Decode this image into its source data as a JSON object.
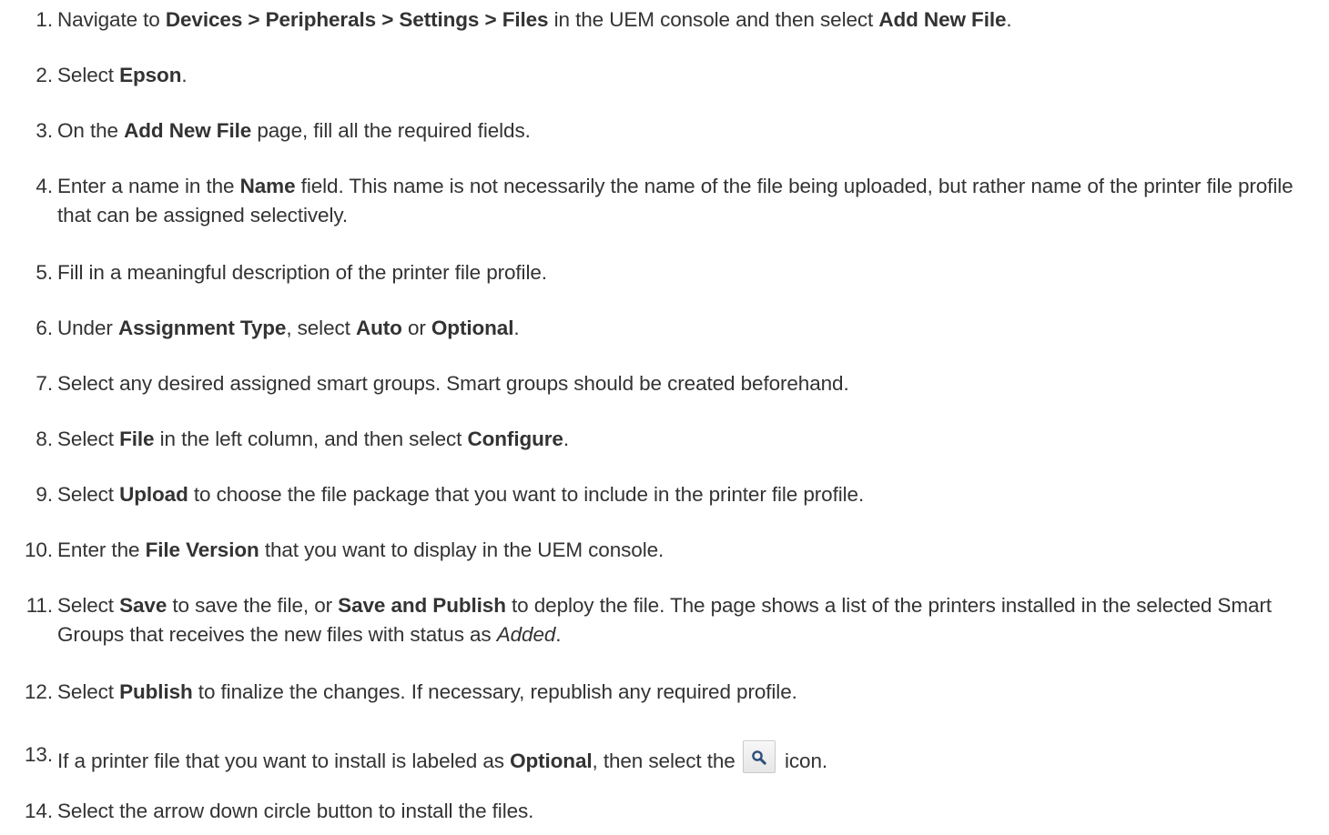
{
  "steps": [
    {
      "num": "1.",
      "parts": [
        {
          "t": "Navigate to "
        },
        {
          "t": "Devices > Peripherals > Settings > Files",
          "b": true
        },
        {
          "t": " in the UEM console and then select "
        },
        {
          "t": "Add New File",
          "b": true
        },
        {
          "t": "."
        }
      ]
    },
    {
      "num": "2.",
      "parts": [
        {
          "t": "Select "
        },
        {
          "t": "Epson",
          "b": true
        },
        {
          "t": "."
        }
      ]
    },
    {
      "num": "3.",
      "parts": [
        {
          "t": "On the "
        },
        {
          "t": "Add New File",
          "b": true
        },
        {
          "t": " page, fill all the required fields."
        }
      ]
    },
    {
      "num": "4.",
      "parts": [
        {
          "t": "Enter a name in the "
        },
        {
          "t": "Name",
          "b": true
        },
        {
          "t": " field. This name is not necessarily the name of the file being uploaded, but rather name of the printer file profile that can be assigned selectively."
        }
      ]
    },
    {
      "num": "5.",
      "parts": [
        {
          "t": "Fill in a meaningful description of the printer file profile."
        }
      ]
    },
    {
      "num": "6.",
      "parts": [
        {
          "t": "Under "
        },
        {
          "t": "Assignment Type",
          "b": true
        },
        {
          "t": ", select "
        },
        {
          "t": "Auto",
          "b": true
        },
        {
          "t": " or "
        },
        {
          "t": "Optional",
          "b": true
        },
        {
          "t": "."
        }
      ]
    },
    {
      "num": "7.",
      "parts": [
        {
          "t": "Select any desired assigned smart groups. Smart groups should be created beforehand."
        }
      ]
    },
    {
      "num": "8.",
      "parts": [
        {
          "t": "Select "
        },
        {
          "t": "File",
          "b": true
        },
        {
          "t": " in the left column, and then select "
        },
        {
          "t": "Configure",
          "b": true
        },
        {
          "t": "."
        }
      ]
    },
    {
      "num": "9.",
      "parts": [
        {
          "t": "Select "
        },
        {
          "t": "Upload",
          "b": true
        },
        {
          "t": " to choose the file package that you want to include in the printer file profile."
        }
      ]
    },
    {
      "num": "10.",
      "parts": [
        {
          "t": "Enter the "
        },
        {
          "t": "File Version",
          "b": true
        },
        {
          "t": " that you want to display in the UEM console."
        }
      ]
    },
    {
      "num": "11.",
      "parts": [
        {
          "t": "Select "
        },
        {
          "t": "Save",
          "b": true
        },
        {
          "t": " to save the file, or "
        },
        {
          "t": "Save and Publish",
          "b": true
        },
        {
          "t": " to deploy the file. The page shows a list of the printers installed in the selected Smart Groups that receives the new files with status as "
        },
        {
          "t": "Added",
          "i": true
        },
        {
          "t": "."
        }
      ]
    },
    {
      "num": "12.",
      "parts": [
        {
          "t": "Select "
        },
        {
          "t": "Publish",
          "b": true
        },
        {
          "t": " to finalize the changes. If necessary, republish any required profile."
        }
      ]
    },
    {
      "num": "13.",
      "parts": [
        {
          "t": "If a printer file that you want to install is labeled as "
        },
        {
          "t": "Optional",
          "b": true
        },
        {
          "t": ", then select the "
        },
        {
          "icon": "search-icon"
        },
        {
          "t": " icon."
        }
      ]
    },
    {
      "num": "14.",
      "parts": [
        {
          "t": "Select the arrow down circle button to install the files."
        }
      ]
    }
  ]
}
